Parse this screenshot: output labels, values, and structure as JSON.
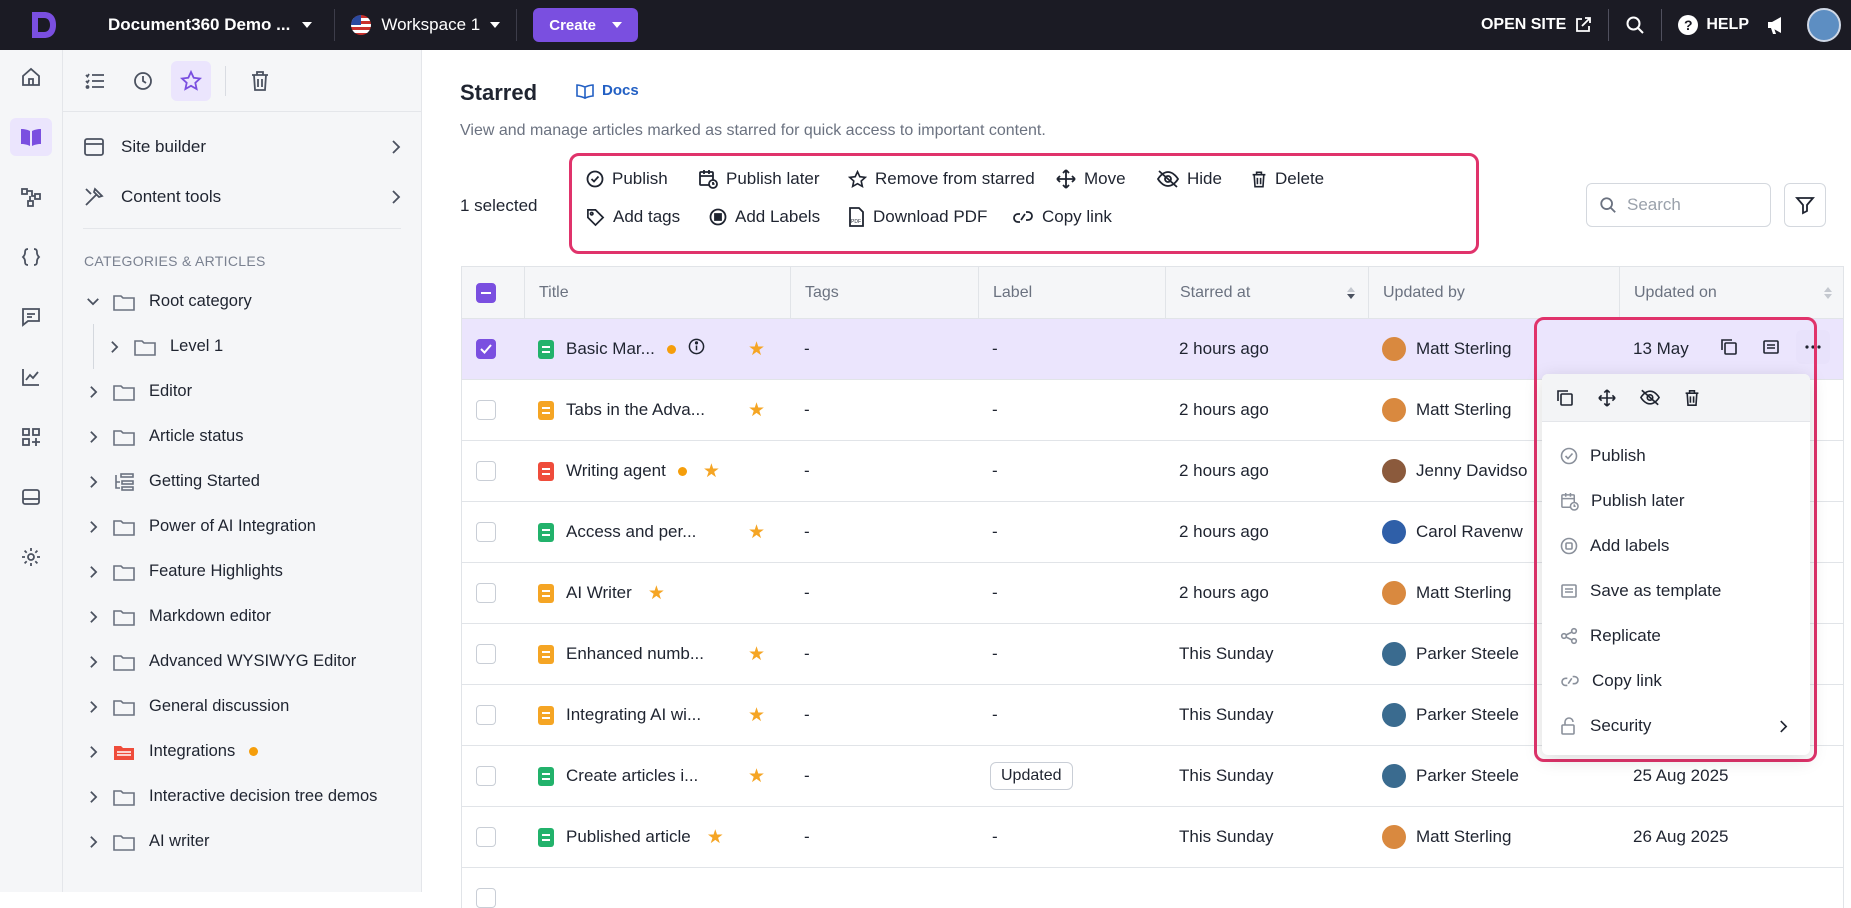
{
  "topbar": {
    "project": "Document360 Demo ...",
    "workspace": "Workspace 1",
    "create": "Create",
    "open_site": "OPEN SITE",
    "help": "HELP"
  },
  "sidebar": {
    "menus": [
      {
        "label": "Site builder"
      },
      {
        "label": "Content tools"
      }
    ],
    "heading": "CATEGORIES & ARTICLES",
    "tree": [
      {
        "label": "Root category",
        "expanded": true
      },
      {
        "label": "Level 1"
      },
      {
        "label": "Editor"
      },
      {
        "label": "Article status"
      },
      {
        "label": "Getting Started"
      },
      {
        "label": "Power of AI Integration"
      },
      {
        "label": "Feature Highlights"
      },
      {
        "label": "Markdown editor"
      },
      {
        "label": "Advanced WYSIWYG Editor"
      },
      {
        "label": "General discussion"
      },
      {
        "label": "Integrations"
      },
      {
        "label": "Interactive decision tree demos"
      },
      {
        "label": "AI writer"
      }
    ]
  },
  "main": {
    "title": "Starred",
    "docs_link": "Docs",
    "subtitle": "View and manage articles marked as starred for quick access to important content.",
    "selected_count": "1 selected",
    "bulk_actions": {
      "publish": "Publish",
      "publish_later": "Publish later",
      "remove_starred": "Remove from starred",
      "move": "Move",
      "hide": "Hide",
      "delete": "Delete",
      "add_tags": "Add tags",
      "add_labels": "Add Labels",
      "download_pdf": "Download PDF",
      "copy_link": "Copy link"
    },
    "search_placeholder": "Search"
  },
  "table": {
    "columns": {
      "title": "Title",
      "tags": "Tags",
      "label": "Label",
      "starred_at": "Starred at",
      "updated_by": "Updated by",
      "updated_on": "Updated on"
    },
    "rows": [
      {
        "title": "Basic Mar...",
        "tags": "-",
        "label": "-",
        "starred": "2 hours ago",
        "user": "Matt Sterling",
        "updated": "13 May"
      },
      {
        "title": "Tabs in the Adva...",
        "tags": "-",
        "label": "-",
        "starred": "2 hours ago",
        "user": "Matt Sterling",
        "updated": ""
      },
      {
        "title": "Writing agent",
        "tags": "-",
        "label": "-",
        "starred": "2 hours ago",
        "user": "Jenny Davidso",
        "updated": ""
      },
      {
        "title": "Access and per...",
        "tags": "-",
        "label": "-",
        "starred": "2 hours ago",
        "user": "Carol Ravenw",
        "updated": ""
      },
      {
        "title": "AI Writer",
        "tags": "-",
        "label": "-",
        "starred": "2 hours ago",
        "user": "Matt Sterling",
        "updated": ""
      },
      {
        "title": "Enhanced numb...",
        "tags": "-",
        "label": "-",
        "starred": "This Sunday",
        "user": "Parker Steele",
        "updated": ""
      },
      {
        "title": "Integrating AI wi...",
        "tags": "-",
        "label": "-",
        "starred": "This Sunday",
        "user": "Parker Steele",
        "updated": ""
      },
      {
        "title": "Create articles i...",
        "tags": "-",
        "label": "Updated",
        "starred": "This Sunday",
        "user": "Parker Steele",
        "updated": "25 Aug 2025"
      },
      {
        "title": "Published article",
        "tags": "-",
        "label": "-",
        "starred": "This Sunday",
        "user": "Matt Sterling",
        "updated": "26 Aug 2025"
      }
    ]
  },
  "context_menu": {
    "items": [
      {
        "label": "Publish"
      },
      {
        "label": "Publish later"
      },
      {
        "label": "Add labels"
      },
      {
        "label": "Save as template"
      },
      {
        "label": "Replicate"
      },
      {
        "label": "Copy link"
      },
      {
        "label": "Security"
      }
    ]
  },
  "colors": {
    "accent": "#7a4fe0",
    "highlight": "#e0336b",
    "topbar": "#1b1b24"
  }
}
